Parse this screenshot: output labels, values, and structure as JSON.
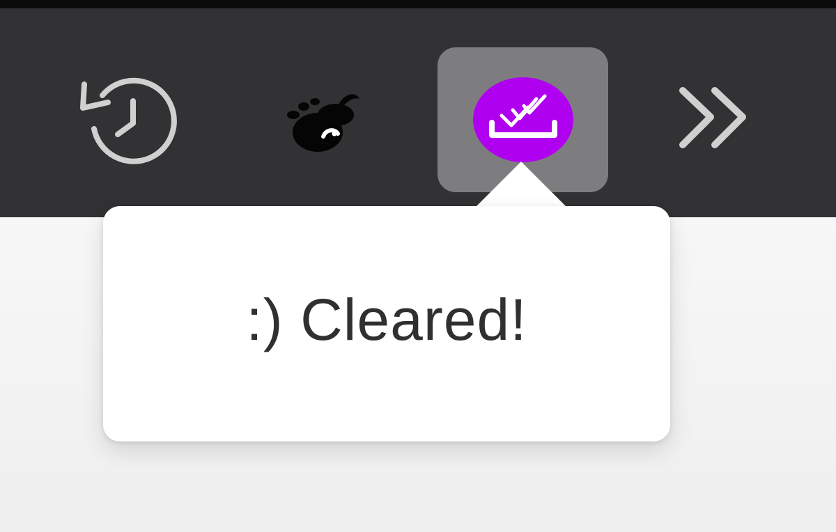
{
  "toolbar": {
    "buttons": [
      {
        "id": "history",
        "icon": "history-icon"
      },
      {
        "id": "gimp",
        "icon": "gimp-icon"
      },
      {
        "id": "clear-downloads",
        "icon": "clear-downloads-icon",
        "accent": "#b000f0"
      },
      {
        "id": "overflow",
        "icon": "double-chevron-icon"
      }
    ],
    "colors": {
      "background": "#323234",
      "active_button": "#7d7d7f",
      "icon_gray": "#d0d0d0"
    }
  },
  "popup": {
    "message": ":) Cleared!",
    "colors": {
      "background": "#ffffff",
      "text": "#303030"
    }
  }
}
